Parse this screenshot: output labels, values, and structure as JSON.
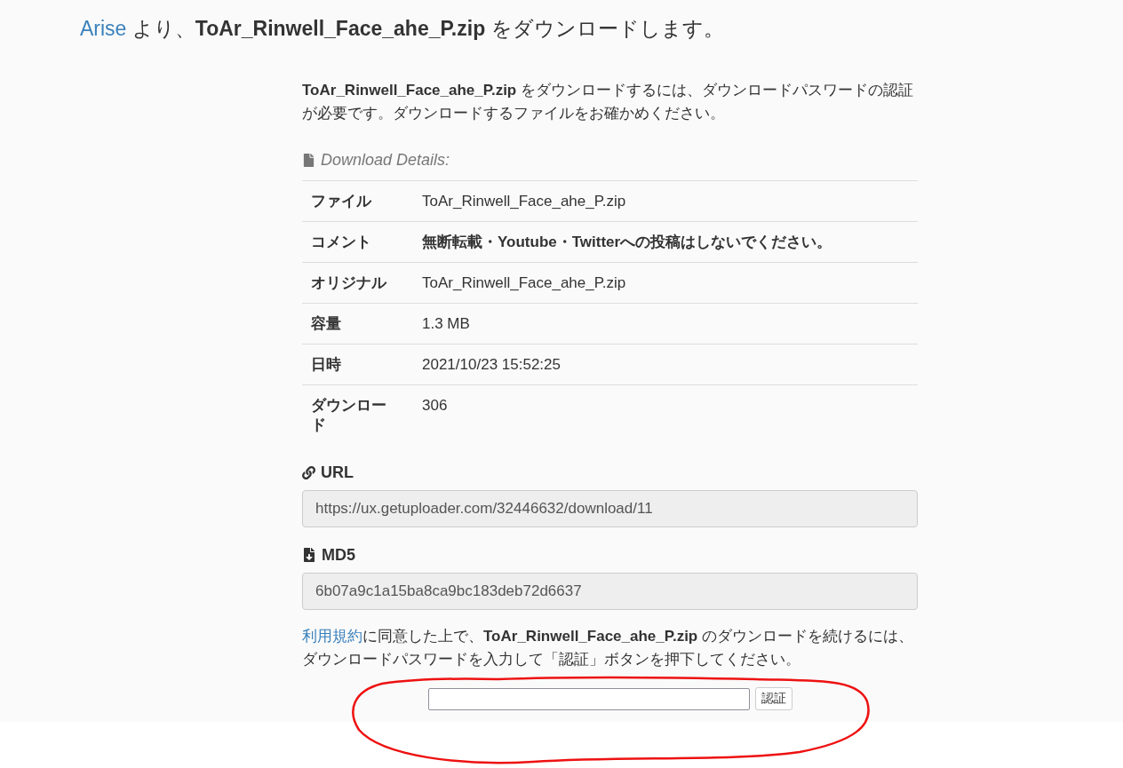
{
  "heading": {
    "link": "Arise",
    "text": "より、**ToAr_Rinwell_Face_ahe_P.zip** をダウンロードします。"
  },
  "intro": "**ToAr_Rinwell_Face_ahe_P.zip** をダウンロードするには、ダウンロードパスワードの認証が必要です。ダウンロードするファイルをお確かめください。",
  "details": {
    "title": "Download Details:",
    "rows": [
      {
        "label": "ファイル",
        "value": "ToAr_Rinwell_Face_ahe_P.zip",
        "kind": "plain"
      },
      {
        "label": "コメント",
        "value": "無断転載・Youtube・Twitterへの投稿はしないでください。",
        "kind": "comment"
      },
      {
        "label": "オリジナル",
        "value": "ToAr_Rinwell_Face_ahe_P.zip",
        "kind": "plain"
      },
      {
        "label": "容量",
        "value": "1.3 MB",
        "kind": "plain"
      },
      {
        "label": "日時",
        "value": "2021/10/23 15:52:25",
        "kind": "plain"
      },
      {
        "label": "ダウンロード",
        "value": "306",
        "kind": "plain"
      }
    ]
  },
  "fields": [
    {
      "kind": "url",
      "label": "URL",
      "value": "https://ux.getuploader.com/32446632/download/11"
    },
    {
      "kind": "md5",
      "label": "MD5",
      "value": "6b07a9c1a15ba8ca9bc183deb72d6637"
    }
  ],
  "terms": {
    "link": "利用規約",
    "text": "に同意した上で、**ToAr_Rinwell_Face_ahe_P.zip** のダウンロードを続けるには、ダウンロードパスワードを入力して「認証」ボタンを押下してください。"
  },
  "auth": {
    "button": "認証"
  }
}
